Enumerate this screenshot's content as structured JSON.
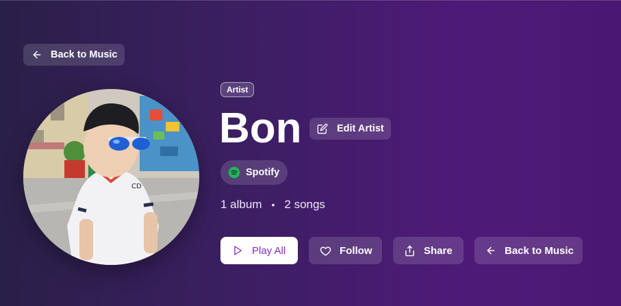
{
  "nav": {
    "back_label": "Back to Music"
  },
  "artist": {
    "role": "Artist",
    "name": "Bon",
    "edit_label": "Edit Artist",
    "source_label": "Spotify",
    "album_count": "1 album",
    "song_count": "2 songs",
    "separator": "•"
  },
  "actions": {
    "play_all": "Play All",
    "follow": "Follow",
    "share": "Share",
    "back": "Back to Music"
  },
  "colors": {
    "accent": "#7b2fbe",
    "spotify_green": "#1db954",
    "background_left": "#2a1f48",
    "background_right": "#4e1a78"
  },
  "icons": {
    "back": "arrow-left-icon",
    "edit": "edit-pencil-icon",
    "spotify": "spotify-icon",
    "play": "play-icon",
    "follow": "heart-icon",
    "share": "share-icon"
  }
}
